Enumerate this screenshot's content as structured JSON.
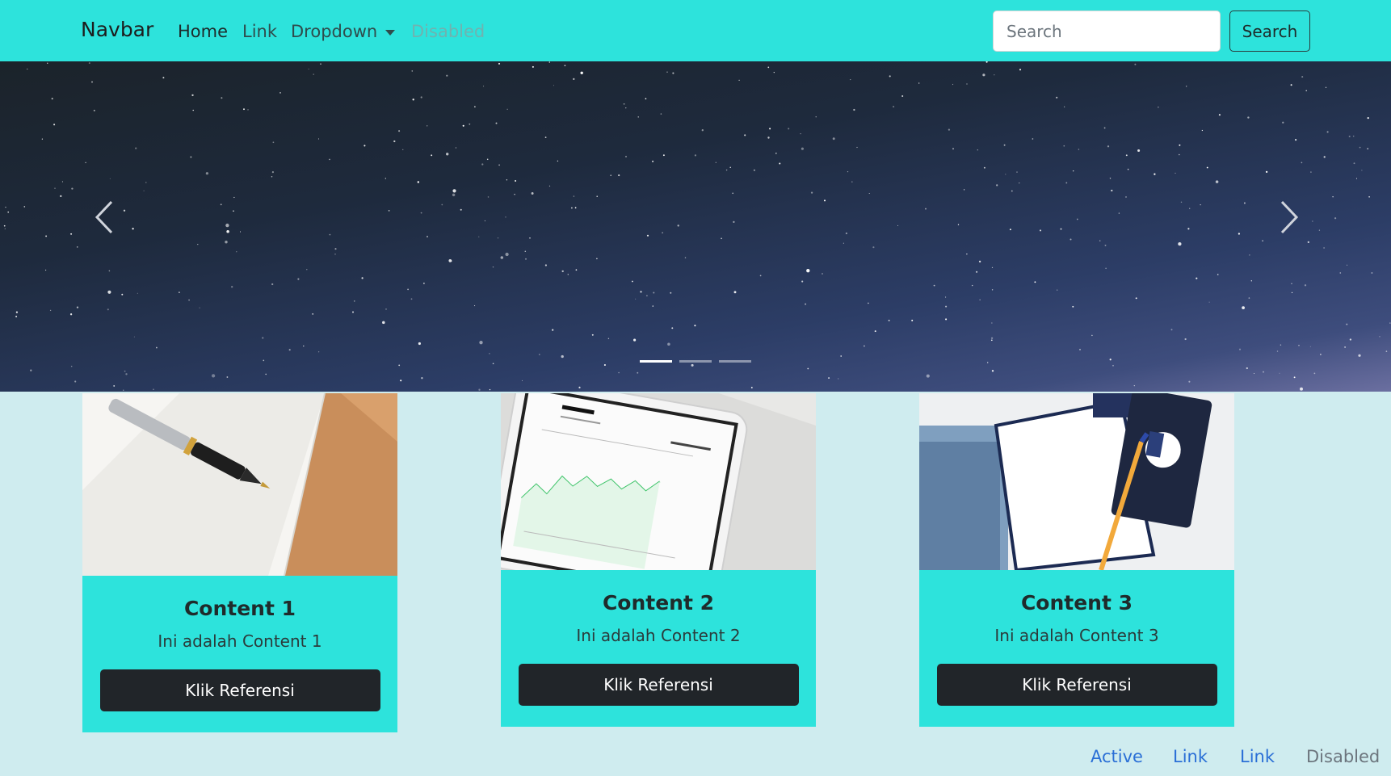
{
  "navbar": {
    "brand": "Navbar",
    "items": [
      {
        "label": "Home"
      },
      {
        "label": "Link"
      },
      {
        "label": "Dropdown"
      },
      {
        "label": "Disabled"
      }
    ],
    "search": {
      "placeholder": "Search",
      "button_label": "Search"
    }
  },
  "carousel": {
    "slide_count": 3,
    "active_index": 0
  },
  "cards": [
    {
      "title": "Content 1",
      "text": "Ini adalah Content 1",
      "button": "Klik Referensi"
    },
    {
      "title": "Content 2",
      "text": "Ini adalah Content 2",
      "button": "Klik Referensi"
    },
    {
      "title": "Content 3",
      "text": "Ini adalah Content 3",
      "button": "Klik Referensi"
    }
  ],
  "footer_nav": [
    {
      "label": "Active"
    },
    {
      "label": "Link"
    },
    {
      "label": "Link"
    },
    {
      "label": "Disabled"
    }
  ],
  "colors": {
    "accent": "#2de3dc",
    "page_background": "#cfecef",
    "button_dark": "#212529",
    "link_blue": "#2a6fd6"
  }
}
